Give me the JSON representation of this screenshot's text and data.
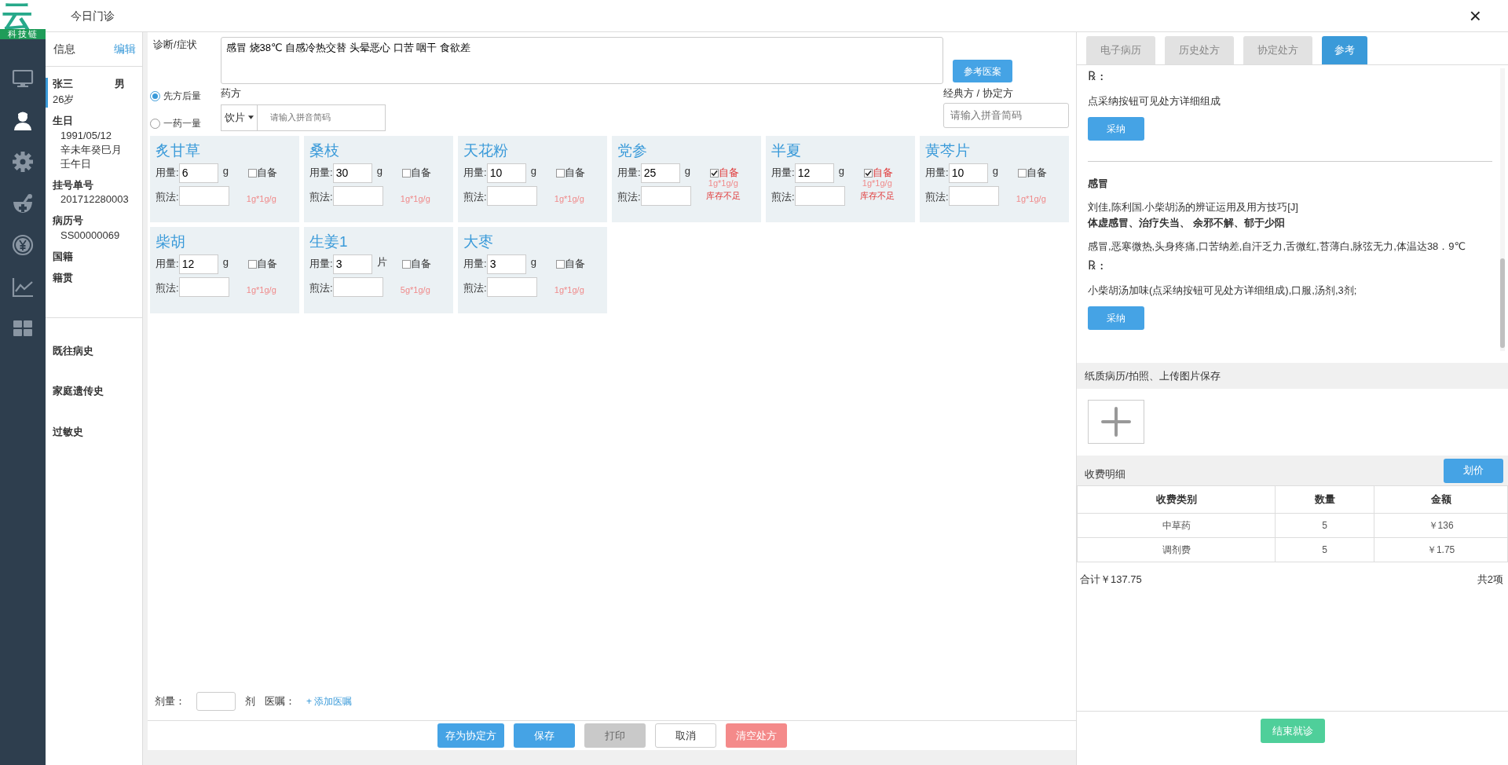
{
  "logo": {
    "text": "云",
    "subtitle": "科技链"
  },
  "nav": [
    {
      "kind": "monitor",
      "selected": false
    },
    {
      "kind": "doctor",
      "selected": true
    },
    {
      "kind": "gear",
      "selected": false
    },
    {
      "kind": "mortar",
      "selected": false
    },
    {
      "kind": "yen",
      "selected": false
    },
    {
      "kind": "chart",
      "selected": false
    },
    {
      "kind": "grid",
      "selected": false
    }
  ],
  "window": {
    "title": "今日门诊",
    "close": "×"
  },
  "patient": {
    "header": "信息",
    "edit": "编辑",
    "name": "张三",
    "gender": "男",
    "age": "26岁",
    "fields": [
      {
        "label": "生日",
        "values": [
          "1991/05/12",
          "辛未年癸巳月",
          "壬午日"
        ]
      },
      {
        "label": "挂号单号",
        "values": [
          "201712280003"
        ]
      },
      {
        "label": "病历号",
        "values": [
          "SS00000069"
        ]
      },
      {
        "label": "国籍"
      },
      {
        "label": "籍贯"
      }
    ]
  },
  "history": [
    "既往病史",
    "家庭遗传史",
    "过敏史"
  ],
  "diagnosis": {
    "label": "诊断/症状",
    "value": "感冒 烧38℃ 自感冷热交替 头晕恶心 口苦 咽干 食欲差",
    "button": "参考医案"
  },
  "modes": [
    {
      "label": "先方后量",
      "selected": true
    },
    {
      "label": "一药一量",
      "selected": false
    }
  ],
  "prescription": {
    "label": "药方",
    "type": "饮片",
    "placeholder": "请输入拼音简码"
  },
  "classic": {
    "label": "经典方 / 协定方",
    "placeholder": "请输入拼音简码"
  },
  "herbs": [
    {
      "name": "炙甘草",
      "dose_label": "用量:",
      "dose": "6",
      "unit": "g",
      "self_label": "自备",
      "self_prepared": false,
      "method_label": "煎法:",
      "spec": "1g*1g/g"
    },
    {
      "name": "桑枝",
      "dose_label": "用量:",
      "dose": "30",
      "unit": "g",
      "self_label": "自备",
      "self_prepared": false,
      "method_label": "煎法:",
      "spec": "1g*1g/g"
    },
    {
      "name": "天花粉",
      "dose_label": "用量:",
      "dose": "10",
      "unit": "g",
      "self_label": "自备",
      "self_prepared": false,
      "method_label": "煎法:",
      "spec": "1g*1g/g"
    },
    {
      "name": "党参",
      "dose_label": "用量:",
      "dose": "25",
      "unit": "g",
      "self_label": "自备",
      "self_prepared": true,
      "method_label": "煎法:",
      "spec": "1g*1g/g",
      "warning": "库存不足"
    },
    {
      "name": "半夏",
      "dose_label": "用量:",
      "dose": "12",
      "unit": "g",
      "self_label": "自备",
      "self_prepared": true,
      "method_label": "煎法:",
      "spec": "1g*1g/g",
      "warning": "库存不足"
    },
    {
      "name": "黄芩片",
      "dose_label": "用量:",
      "dose": "10",
      "unit": "g",
      "self_label": "自备",
      "self_prepared": false,
      "method_label": "煎法:",
      "spec": "1g*1g/g"
    },
    {
      "name": "柴胡",
      "dose_label": "用量:",
      "dose": "12",
      "unit": "g",
      "self_label": "自备",
      "self_prepared": false,
      "method_label": "煎法:",
      "spec": "1g*1g/g"
    },
    {
      "name": "生姜1",
      "dose_label": "用量:",
      "dose": "3",
      "unit": "片",
      "self_label": "自备",
      "self_prepared": false,
      "method_label": "煎法:",
      "spec": "5g*1g/g"
    },
    {
      "name": "大枣",
      "dose_label": "用量:",
      "dose": "3",
      "unit": "g",
      "self_label": "自备",
      "self_prepared": false,
      "method_label": "煎法:",
      "spec": "1g*1g/g"
    }
  ],
  "dosage": {
    "label": "剂量：",
    "unit": "剂",
    "advice_label": "医嘱：",
    "add_advice": "+ 添加医嘱"
  },
  "actions": [
    {
      "label": "存为协定方",
      "kind": "primary"
    },
    {
      "label": "保存",
      "kind": "primary"
    },
    {
      "label": "打印",
      "kind": "disabled"
    },
    {
      "label": "取消",
      "kind": "outline"
    },
    {
      "label": "清空处方",
      "kind": "danger"
    }
  ],
  "right_tabs": [
    {
      "label": "电子病历",
      "selected": false
    },
    {
      "label": "历史处方",
      "selected": false
    },
    {
      "label": "协定处方",
      "selected": false
    },
    {
      "label": "参考",
      "selected": true
    }
  ],
  "references": [
    {
      "blocks": [
        {
          "kind": "rx",
          "text": "℞ :"
        },
        {
          "kind": "text",
          "text": "点采纳按钮可见处方详细组成"
        },
        {
          "kind": "button",
          "text": "采纳"
        }
      ]
    },
    {
      "blocks": [
        {
          "kind": "title",
          "text": "感冒"
        },
        {
          "kind": "text",
          "text": "刘佳,陈利国.小柴胡汤的辨证运用及用方技巧[J]"
        },
        {
          "kind": "bold",
          "text": "体虚感冒、治疗失当、 余邪不解、郁于少阳"
        },
        {
          "kind": "text",
          "text": "感冒,恶寒微热,头身疼痛,口苦纳差,自汗乏力,舌微红,苔薄白,脉弦无力,体温达38．9℃"
        },
        {
          "kind": "rx",
          "text": "℞ :"
        },
        {
          "kind": "text",
          "text": "小柴胡汤加味(点采纳按钮可见处方详细组成),口服,汤剂,3剂;"
        },
        {
          "kind": "button",
          "text": "采纳"
        }
      ]
    }
  ],
  "upload": {
    "title": "纸质病历/拍照、上传图片保存"
  },
  "fees": {
    "title": "收费明细",
    "button": "划价",
    "columns": [
      "收费类别",
      "数量",
      "金额"
    ],
    "rows": [
      [
        "中草药",
        "5",
        "￥136"
      ],
      [
        "调剂费",
        "5",
        "￥1.75"
      ]
    ],
    "total": "合计￥137.75",
    "count": "共2项"
  },
  "finish": "结束就诊"
}
